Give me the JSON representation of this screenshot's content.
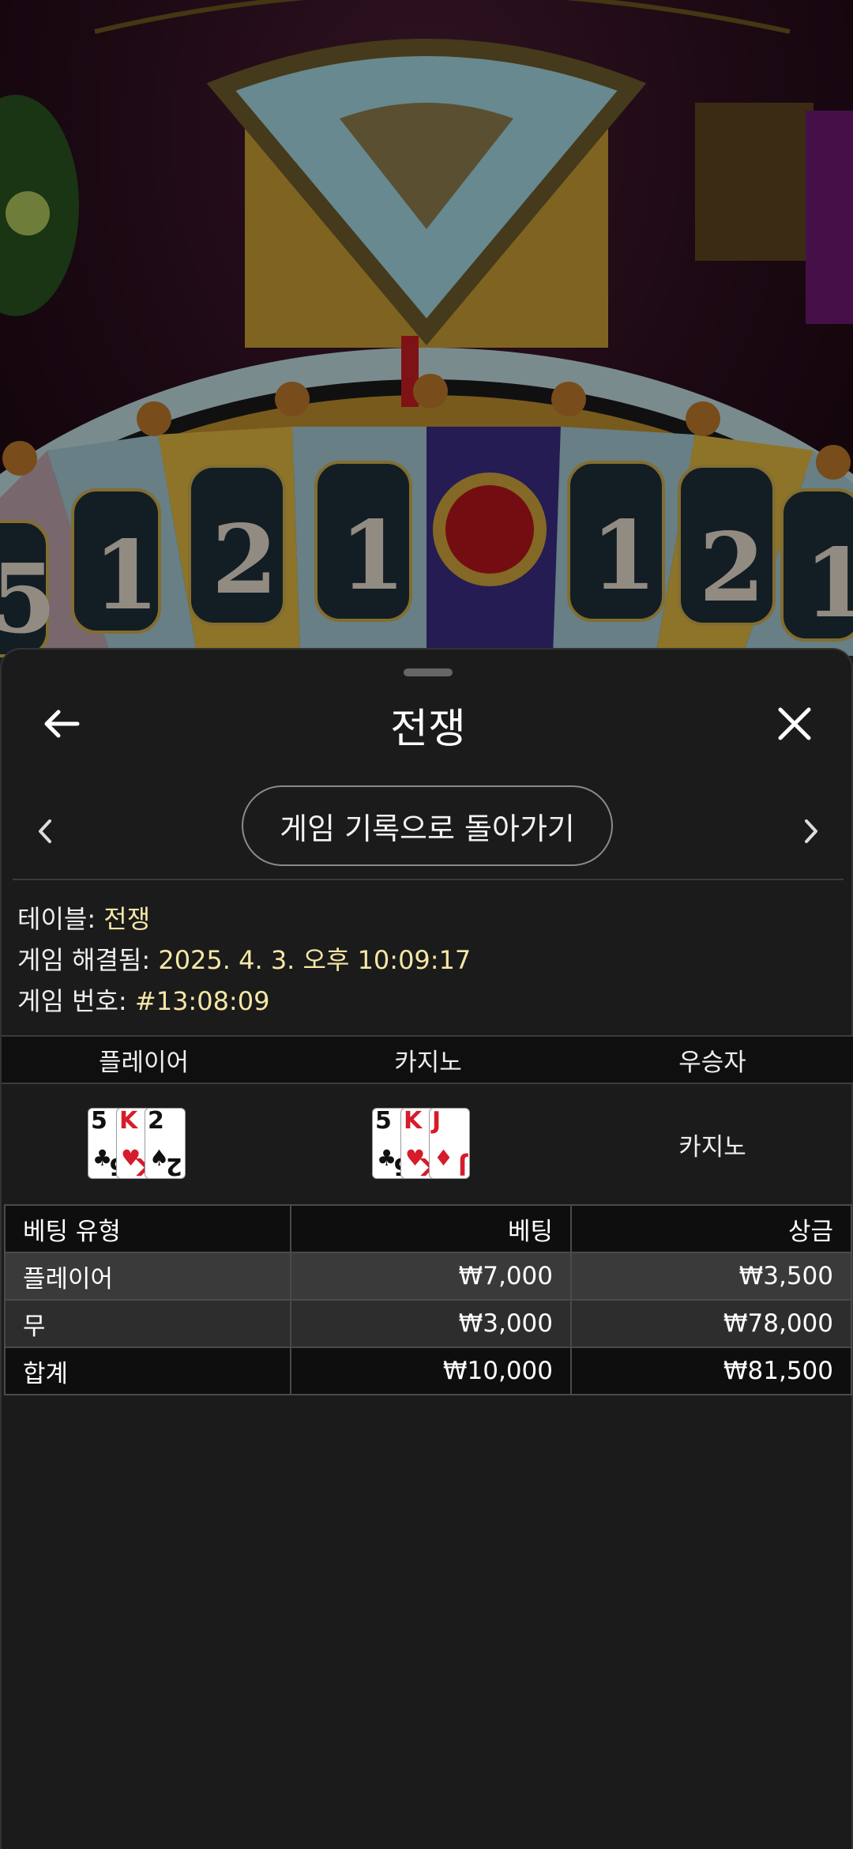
{
  "header": {
    "title": "전쟁",
    "back_icon": "arrow-left-icon",
    "close_icon": "close-icon"
  },
  "nav": {
    "back_to_history_label": "게임 기록으로 돌아가기",
    "prev_icon": "chevron-left-icon",
    "next_icon": "chevron-right-icon"
  },
  "info": {
    "table_label": "테이블: ",
    "table_value": "전쟁",
    "resolved_label": "게임 해결됨: ",
    "resolved_value": "2025. 4. 3. 오후 10:09:17",
    "game_number_label": "게임 번호: ",
    "game_number_value": "#13:08:09"
  },
  "result": {
    "headers": [
      "플레이어",
      "카지노",
      "우승자"
    ],
    "player_cards": [
      {
        "rank": "5",
        "suit": "♣",
        "color": "black"
      },
      {
        "rank": "K",
        "suit": "♥",
        "color": "red"
      },
      {
        "rank": "2",
        "suit": "♠",
        "color": "black"
      }
    ],
    "casino_cards": [
      {
        "rank": "5",
        "suit": "♣",
        "color": "black"
      },
      {
        "rank": "K",
        "suit": "♥",
        "color": "red"
      },
      {
        "rank": "J",
        "suit": "♦",
        "color": "red"
      }
    ],
    "winner": "카지노"
  },
  "bets": {
    "headers": [
      "베팅 유형",
      "베팅",
      "상금"
    ],
    "rows": [
      [
        "플레이어",
        "₩7,000",
        "₩3,500"
      ],
      [
        "무",
        "₩3,000",
        "₩78,000"
      ]
    ],
    "total": [
      "합계",
      "₩10,000",
      "₩81,500"
    ]
  },
  "colors": {
    "accent_value": "#f6e7a6",
    "sheet_bg": "#1b1b1b"
  }
}
